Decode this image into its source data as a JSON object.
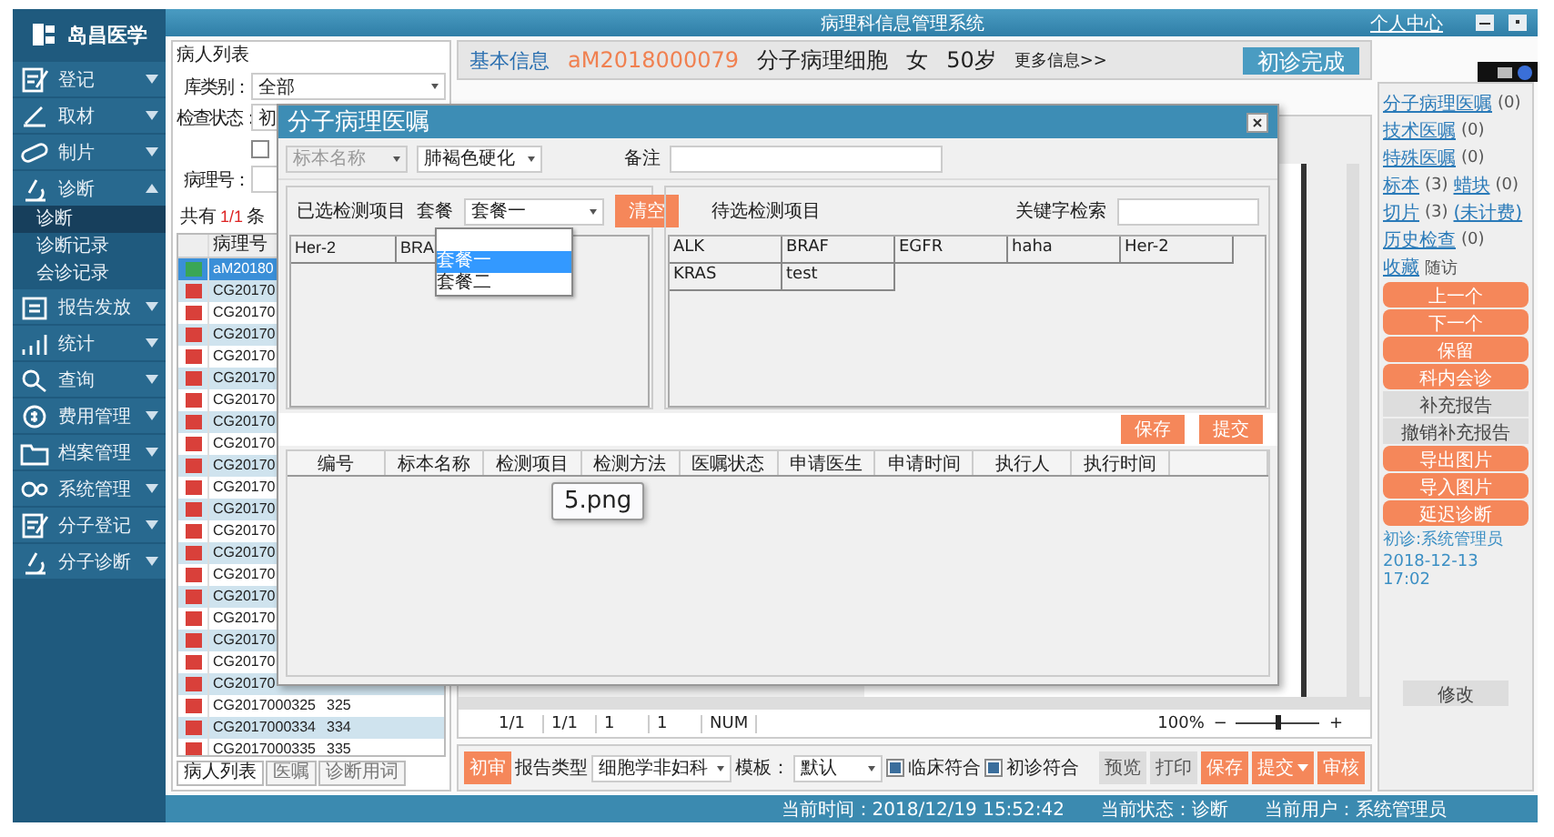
{
  "app": {
    "logo": "岛昌医学",
    "title": "病理科信息管理系统",
    "user_link": "个人中心"
  },
  "sidebar": {
    "items": [
      {
        "label": "登记",
        "expanded": false
      },
      {
        "label": "取材",
        "expanded": false
      },
      {
        "label": "制片",
        "expanded": false
      },
      {
        "label": "诊断",
        "expanded": true,
        "children": [
          {
            "label": "诊断",
            "selected": true
          },
          {
            "label": "诊断记录",
            "selected": false
          },
          {
            "label": "会诊记录",
            "selected": false
          }
        ]
      },
      {
        "label": "报告发放",
        "expanded": false
      },
      {
        "label": "统计",
        "expanded": false
      },
      {
        "label": "查询",
        "expanded": false
      },
      {
        "label": "费用管理",
        "expanded": false
      },
      {
        "label": "档案管理",
        "expanded": false
      },
      {
        "label": "系统管理",
        "expanded": false
      },
      {
        "label": "分子登记",
        "expanded": false
      },
      {
        "label": "分子诊断",
        "expanded": false
      }
    ]
  },
  "patient_list": {
    "title": "病人列表",
    "filters": [
      {
        "label": "库类别：",
        "value": "全部"
      },
      {
        "label": "检查状态：",
        "value": "初"
      }
    ],
    "only_checkbox": {
      "checked": false
    },
    "pathology_no": {
      "label": "病理号："
    },
    "count": {
      "prefix": "共有",
      "value": "1/1",
      "suffix": "条"
    },
    "columns": [
      "病理号"
    ],
    "rows": [
      {
        "id": "aM20180",
        "color": "#3aa655",
        "selected": true
      },
      {
        "id": "CG20170",
        "color": "#d9403a",
        "selected": false
      },
      {
        "id": "CG20170",
        "color": "#d9403a",
        "selected": false
      },
      {
        "id": "CG20170",
        "color": "#d9403a",
        "selected": false
      },
      {
        "id": "CG20170",
        "color": "#d9403a",
        "selected": false
      },
      {
        "id": "CG20170",
        "color": "#d9403a",
        "selected": false
      },
      {
        "id": "CG20170",
        "color": "#d9403a",
        "selected": false
      },
      {
        "id": "CG20170",
        "color": "#d9403a",
        "selected": false
      },
      {
        "id": "CG20170",
        "color": "#d9403a",
        "selected": false
      },
      {
        "id": "CG20170",
        "color": "#d9403a",
        "selected": false
      },
      {
        "id": "CG20170",
        "color": "#d9403a",
        "selected": false
      },
      {
        "id": "CG20170",
        "color": "#d9403a",
        "selected": false
      },
      {
        "id": "CG20170",
        "color": "#d9403a",
        "selected": false
      },
      {
        "id": "CG20170",
        "color": "#d9403a",
        "selected": false
      },
      {
        "id": "CG20170",
        "color": "#d9403a",
        "selected": false
      },
      {
        "id": "CG20170",
        "color": "#d9403a",
        "selected": false
      },
      {
        "id": "CG20170",
        "color": "#d9403a",
        "selected": false
      },
      {
        "id": "CG20170",
        "color": "#d9403a",
        "selected": false
      },
      {
        "id": "CG20170",
        "color": "#d9403a",
        "selected": false
      },
      {
        "id": "CG20170",
        "color": "#d9403a",
        "selected": false
      },
      {
        "id": "CG2017000325",
        "no": "325",
        "color": "#d9403a",
        "selected": false
      },
      {
        "id": "CG2017000334",
        "no": "334",
        "color": "#d9403a",
        "selected": false
      },
      {
        "id": "CG2017000335",
        "no": "335",
        "color": "#d9403a",
        "selected": false
      }
    ],
    "tabs": [
      {
        "label": "病人列表",
        "selected": true
      },
      {
        "label": "医嘱",
        "selected": false
      },
      {
        "label": "诊断用词",
        "selected": false
      }
    ]
  },
  "header": {
    "label": "基本信息",
    "case_no": "aM2018000079",
    "type": "分子病理细胞",
    "gender": "女",
    "age": "50岁",
    "more": "更多信息>>",
    "complete_button": "初诊完成"
  },
  "dialog": {
    "title": "分子病理医嘱",
    "specimen": {
      "placeholder": "标本名称",
      "disabled": true
    },
    "site": {
      "value": "肺褐色硬化"
    },
    "note": {
      "label": "备注"
    },
    "selected_panel": {
      "title": "已选检测项目",
      "package_label": "套餐",
      "package_value": "套餐一",
      "clear_button": "清空",
      "items": [
        "Her-2",
        "BRA"
      ]
    },
    "dropdown": {
      "options": [
        {
          "label": "套餐一",
          "selected": true
        },
        {
          "label": "套餐二",
          "selected": false
        }
      ]
    },
    "available_panel": {
      "title": "待选检测项目",
      "search_label": "关键字检索",
      "items": [
        "ALK",
        "BRAF",
        "EGFR",
        "haha",
        "Her-2",
        "KRAS",
        "test"
      ]
    },
    "buttons": [
      "保存",
      "提交"
    ],
    "orders_table": {
      "columns": [
        "编号",
        "标本名称",
        "检测项目",
        "检测方法",
        "医嘱状态",
        "申请医生",
        "申请时间",
        "执行人",
        "执行时间"
      ]
    }
  },
  "tooltip": "5.png",
  "editor": {
    "status": [
      "1/1",
      "1/1",
      "1",
      "1",
      "NUM"
    ],
    "zoom": "100%",
    "zoom_out": "−",
    "zoom_in": "+",
    "zoom_slider": {
      "level": 0.5
    }
  },
  "toolbar": {
    "first_button": "初审",
    "report_type": {
      "label": "报告类型",
      "value": "细胞学非妇科"
    },
    "template": {
      "label": "模板：",
      "value": "默认"
    },
    "checks": [
      {
        "label": "临床符合",
        "checked": true
      },
      {
        "label": "初诊符合",
        "checked": true
      }
    ],
    "buttons": [
      {
        "label": "预览",
        "kind": "plain"
      },
      {
        "label": "打印",
        "kind": "plain"
      },
      {
        "label": "保存",
        "kind": "primary"
      },
      {
        "label": "提交",
        "kind": "split"
      },
      {
        "label": "审核",
        "kind": "primary"
      }
    ]
  },
  "right_panel": {
    "lines": [
      [
        {
          "text": "分子病理医嘱",
          "kind": "link"
        },
        {
          "text": "(0)",
          "kind": "text"
        }
      ],
      [
        {
          "text": "技术医嘱",
          "kind": "link"
        },
        {
          "text": "(0)",
          "kind": "text"
        }
      ],
      [
        {
          "text": "特殊医嘱",
          "kind": "link"
        },
        {
          "text": "(0)",
          "kind": "text"
        }
      ],
      [
        {
          "text": "标本",
          "kind": "link"
        },
        {
          "text": "(3)",
          "kind": "text"
        },
        {
          "text": "蜡块",
          "kind": "link"
        },
        {
          "text": "(0)",
          "kind": "text"
        }
      ],
      [
        {
          "text": "切片",
          "kind": "link"
        },
        {
          "text": "(3)",
          "kind": "text"
        },
        {
          "text": "(未计费)",
          "kind": "link"
        }
      ],
      [
        {
          "text": "历史检查",
          "kind": "link"
        },
        {
          "text": "(0)",
          "kind": "text"
        }
      ],
      [
        {
          "text": "收藏",
          "kind": "link"
        },
        {
          "text": "随访",
          "kind": "text"
        }
      ]
    ],
    "buttons": [
      {
        "label": "上一个",
        "kind": "primary"
      },
      {
        "label": "下一个",
        "kind": "primary"
      },
      {
        "label": "保留",
        "kind": "primary"
      },
      {
        "label": "科内会诊",
        "kind": "primary"
      },
      {
        "label": "补充报告",
        "kind": "plain"
      },
      {
        "label": "撤销补充报告",
        "kind": "plain"
      },
      {
        "label": "导出图片",
        "kind": "primary"
      },
      {
        "label": "导入图片",
        "kind": "primary"
      },
      {
        "label": "延迟诊断",
        "kind": "primary"
      }
    ],
    "note": [
      "初诊:系统管理员",
      "2018-12-13 17:02"
    ],
    "modify_button": "修改"
  },
  "status_bar": [
    "当前时间：2018/12/19 15:52:42",
    "当前状态：诊断",
    "当前用户：系统管理员"
  ]
}
